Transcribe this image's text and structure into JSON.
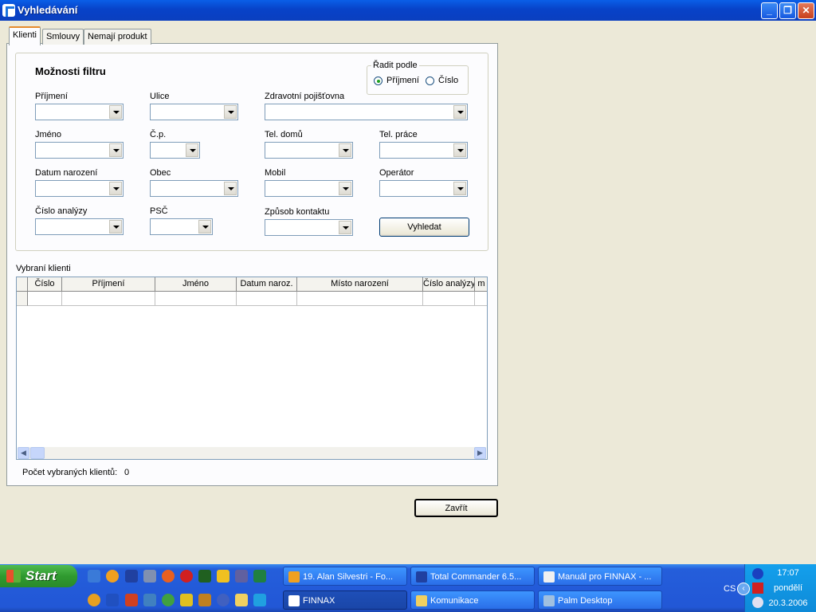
{
  "window": {
    "title": "Vyhledávání"
  },
  "tabs": [
    {
      "label": "Klienti",
      "active": true
    },
    {
      "label": "Smlouvy",
      "active": false
    },
    {
      "label": "Nemají produkt",
      "active": false
    }
  ],
  "filter": {
    "title": "Možnosti filtru",
    "sort": {
      "label": "Řadit podle",
      "options": [
        "Příjmení",
        "Číslo"
      ],
      "selected": "Příjmení"
    },
    "fields": {
      "prijmeni": {
        "label": "Příjmení",
        "value": ""
      },
      "ulice": {
        "label": "Ulice",
        "value": ""
      },
      "pojistovna": {
        "label": "Zdravotní pojišťovna",
        "value": ""
      },
      "jmeno": {
        "label": "Jméno",
        "value": ""
      },
      "cp": {
        "label": "Č.p.",
        "value": ""
      },
      "tel_domu": {
        "label": "Tel. domů",
        "value": ""
      },
      "tel_prace": {
        "label": "Tel. práce",
        "value": ""
      },
      "datum_narozeni": {
        "label": "Datum narození",
        "value": ""
      },
      "obec": {
        "label": "Obec",
        "value": ""
      },
      "mobil": {
        "label": "Mobil",
        "value": ""
      },
      "operator": {
        "label": "Operátor",
        "value": ""
      },
      "cislo_analyzy": {
        "label": "Číslo analýzy",
        "value": ""
      },
      "psc": {
        "label": "PSČ",
        "value": ""
      },
      "zpusob_kontaktu": {
        "label": "Způsob kontaktu",
        "value": ""
      }
    },
    "search_button": "Vyhledat"
  },
  "grid": {
    "title": "Vybraní klienti",
    "columns": [
      "Číslo",
      "Příjmení",
      "Jméno",
      "Datum naroz.",
      "Místo narození",
      "Číslo analýzy",
      "m"
    ],
    "rows": []
  },
  "count": {
    "label": "Počet vybraných klientů:",
    "value": "0"
  },
  "close_button": "Zavřít",
  "taskbar": {
    "start": "Start",
    "tasks": [
      {
        "label": "19. Alan Silvestri - Fo...",
        "active": false
      },
      {
        "label": "Total Commander 6.5...",
        "active": false
      },
      {
        "label": "Manuál pro FINNAX - ...",
        "active": false
      },
      {
        "label": "FINNAX",
        "active": true
      },
      {
        "label": "Komunikace",
        "active": false
      },
      {
        "label": "Palm Desktop",
        "active": false
      }
    ],
    "language": "CS",
    "clock": {
      "time": "17:07",
      "day": "pondělí",
      "date": "20.3.2006"
    }
  }
}
